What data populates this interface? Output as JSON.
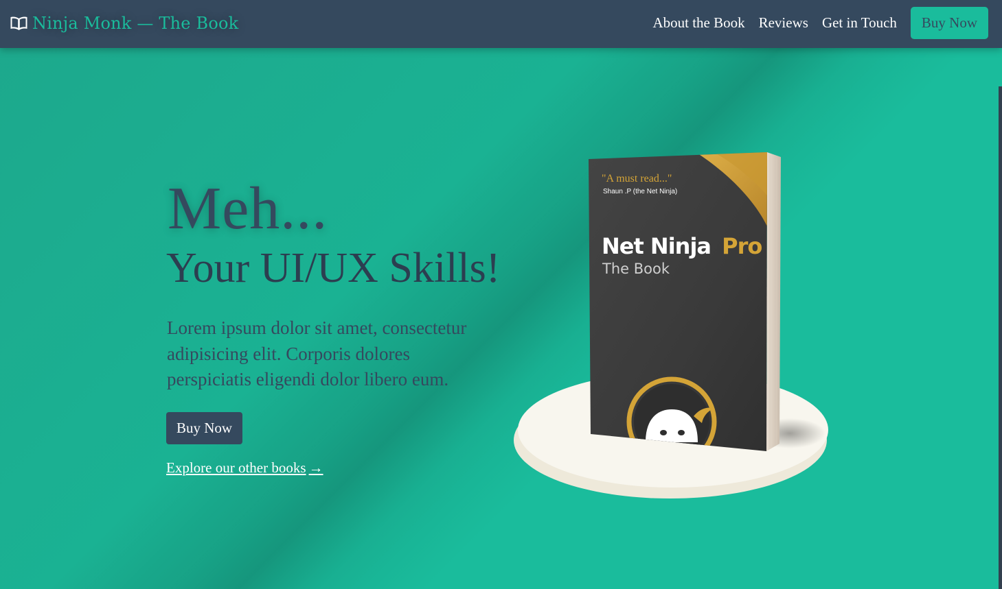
{
  "navbar": {
    "brand_icon": "open-book-icon",
    "brand_text": "Ninja Monk — The Book",
    "links": [
      "About the Book",
      "Reviews",
      "Get in Touch"
    ],
    "buy_label": "Buy Now"
  },
  "hero": {
    "title": "Meh...",
    "subtitle": "Your UI/UX Skills!",
    "body": "Lorem ipsum dolor sit amet, consectetur adipisicing elit. Corporis dolores perspiciatis eligendi dolor libero eum.",
    "buy_label": "Buy Now",
    "explore_label": "Explore our other books ",
    "explore_arrow": "→"
  },
  "book": {
    "quote": "\"A must read...\"",
    "quote_author": "Shaun .P (the Net Ninja)",
    "title_main": "Net Ninja",
    "title_accent": "Pro",
    "subtitle": "The Book",
    "logo_icon": "ninja-face-icon"
  },
  "colors": {
    "primary": "#1abc9c",
    "dark": "#35495e",
    "gold": "#d4a437",
    "cover": "#3b3b3b",
    "plate": "#f8f6ee"
  }
}
